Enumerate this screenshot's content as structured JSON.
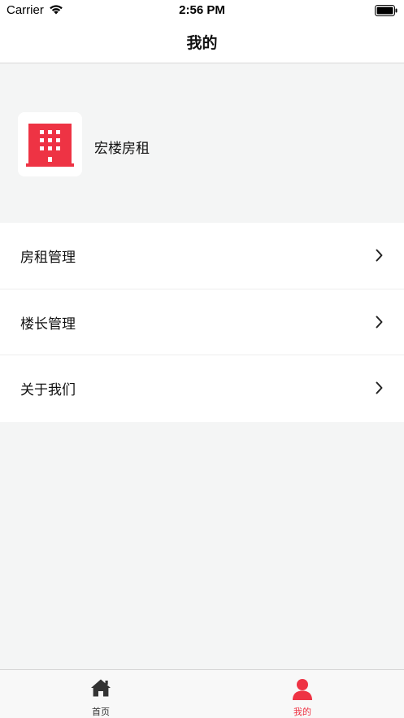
{
  "status_bar": {
    "carrier": "Carrier",
    "time": "2:56 PM"
  },
  "nav": {
    "title": "我的"
  },
  "profile": {
    "name": "宏楼房租",
    "logo_icon": "building-icon",
    "logo_color": "#ee3344"
  },
  "menu": {
    "items": [
      {
        "label": "房租管理",
        "icon": "chevron-right-icon"
      },
      {
        "label": "楼长管理",
        "icon": "chevron-right-icon"
      },
      {
        "label": "关于我们",
        "icon": "chevron-right-icon"
      }
    ]
  },
  "tab_bar": {
    "tabs": [
      {
        "label": "首页",
        "icon": "home-icon",
        "active": false
      },
      {
        "label": "我的",
        "icon": "person-icon",
        "active": true
      }
    ],
    "active_color": "#ee3344",
    "inactive_color": "#333333"
  }
}
